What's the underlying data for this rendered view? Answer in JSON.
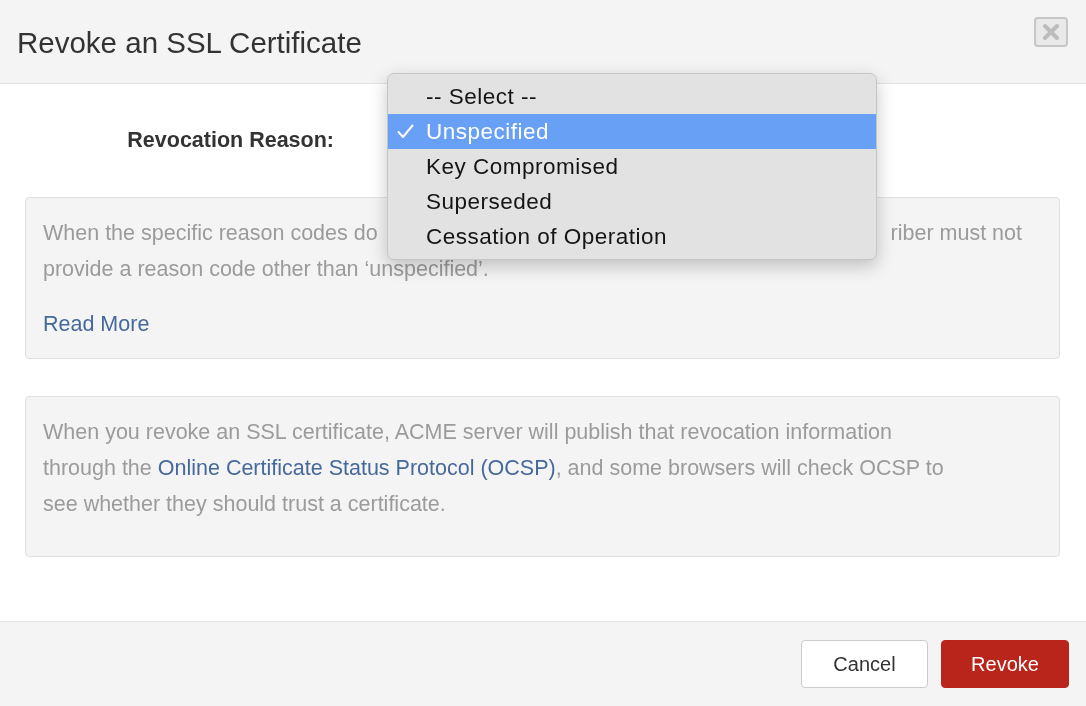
{
  "dialog": {
    "title": "Revoke an SSL Certificate"
  },
  "reason_field": {
    "label": "Revocation Reason:",
    "options": [
      {
        "label": "-- Select --",
        "selected": false
      },
      {
        "label": "Unspecified",
        "selected": true
      },
      {
        "label": "Key Compromised",
        "selected": false
      },
      {
        "label": "Superseded",
        "selected": false
      },
      {
        "label": "Cessation of Operation",
        "selected": false
      }
    ]
  },
  "reason_note": {
    "line_1_start": "When the specific reason codes do",
    "line_1_end": "riber must not",
    "line_2": "provide a reason code other than ‘unspecified’.",
    "link": "Read More"
  },
  "ocsp_note": {
    "line_1": "When you revoke an SSL certificate, ACME server will publish that revocation information",
    "text_before_link": "through the ",
    "link": "Online Certificate Status Protocol (OCSP)",
    "text_after_link": ", and some browsers will check OCSP to see whether they should trust a certificate."
  },
  "buttons": [
    {
      "label": "Cancel",
      "kind": "secondary"
    },
    {
      "label": "Revoke",
      "kind": "danger"
    }
  ]
}
